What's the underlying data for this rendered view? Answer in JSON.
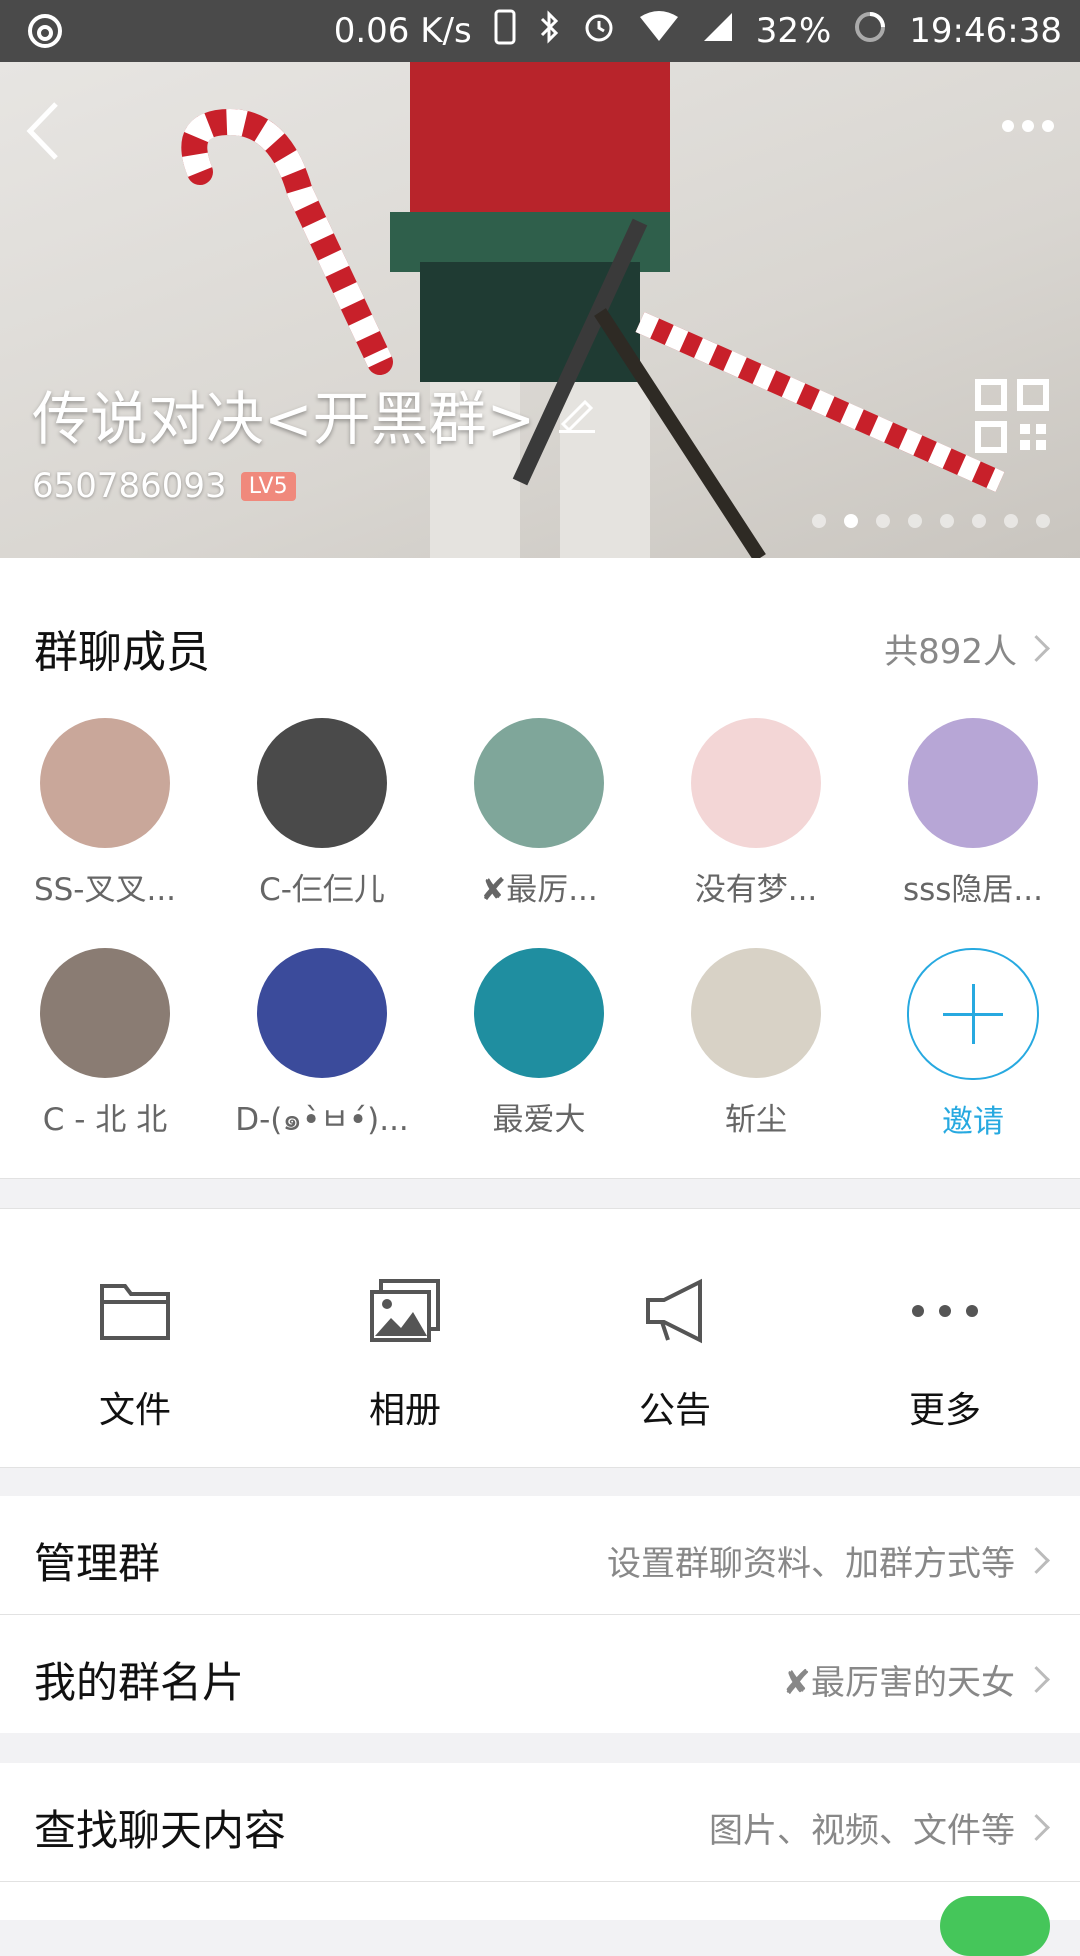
{
  "status_bar": {
    "speed": "0.06 K/s",
    "battery": "32%",
    "time": "19:46:38"
  },
  "header": {
    "group_name": "传说对决<开黑群>",
    "group_id": "650786093",
    "level_badge": "LV5",
    "carousel_total": 8,
    "carousel_active": 2
  },
  "members": {
    "title": "群聊成员",
    "count_label": "共892人",
    "list": [
      {
        "name": "SS-叉叉...",
        "color": "#c9a79a"
      },
      {
        "name": "C-仨仨儿",
        "color": "#4a4a4a"
      },
      {
        "name": "✘最厉...",
        "color": "#7fa69a"
      },
      {
        "name": "没有梦...",
        "color": "#f3d6d6"
      },
      {
        "name": "sss隐居...",
        "color": "#b7a6d6"
      },
      {
        "name": "C - 北 北",
        "color": "#8a7c73"
      },
      {
        "name": "D-(๑•̀ㅂ•́)...",
        "color": "#3b4b9b"
      },
      {
        "name": "最爱大",
        "color": "#1f8ea0"
      },
      {
        "name": "斩尘",
        "color": "#d8d2c6"
      }
    ],
    "invite_label": "邀请"
  },
  "tools": [
    {
      "label": "文件",
      "icon": "folder-icon"
    },
    {
      "label": "相册",
      "icon": "album-icon"
    },
    {
      "label": "公告",
      "icon": "megaphone-icon"
    },
    {
      "label": "更多",
      "icon": "more-icon"
    }
  ],
  "rows": {
    "manage": {
      "label": "管理群",
      "value": "设置群聊资料、加群方式等"
    },
    "card": {
      "label": "我的群名片",
      "value": "✘最厉害的天女"
    },
    "search": {
      "label": "查找聊天内容",
      "value": "图片、视频、文件等"
    }
  },
  "colors": {
    "accent": "#27a9e0",
    "badge": "#f0897c",
    "toggle_on": "#45c65a"
  }
}
